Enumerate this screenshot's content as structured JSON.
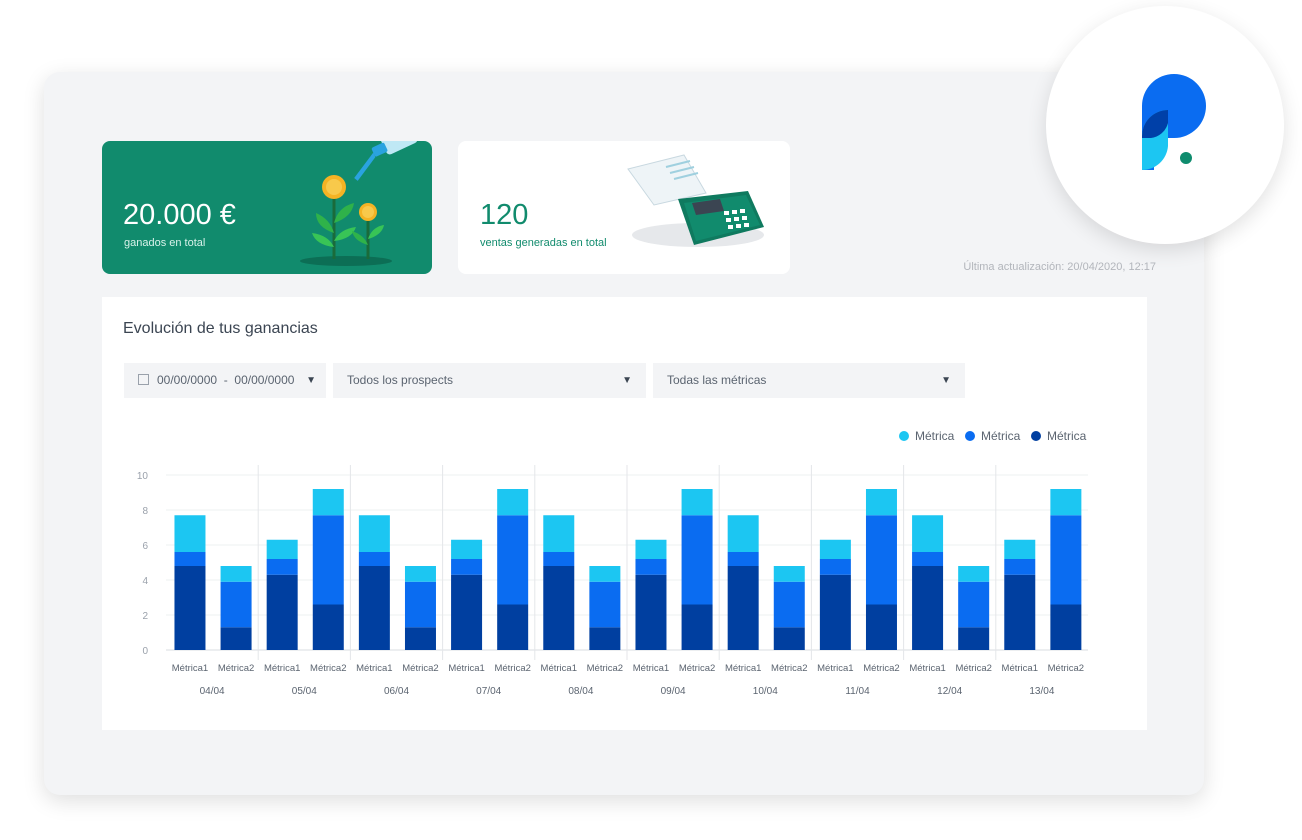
{
  "summary": {
    "earned_value": "20.000 €",
    "earned_label": "ganados en total",
    "sales_value": "120",
    "sales_label": "ventas generadas en total",
    "last_update": "Última actualización: 20/04/2020, 12:17"
  },
  "filters": {
    "date_range": "00/00/0000  -  00/00/0000",
    "prospects": "Todos los prospects",
    "metrics": "Todas las métricas"
  },
  "chart_data": {
    "type": "bar",
    "stacked": true,
    "title": "Evolución de tus ganancias",
    "ylim": [
      0,
      10
    ],
    "yticks": [
      0,
      2,
      4,
      6,
      8,
      10
    ],
    "grid": true,
    "legend_position": "top-right",
    "legend": [
      "Métrica",
      "Métrica",
      "Métrica"
    ],
    "colors": [
      "#003fa0",
      "#0a6cf1",
      "#1cc6f2"
    ],
    "groups": [
      "04/04",
      "05/04",
      "06/04",
      "07/04",
      "08/04",
      "09/04",
      "10/04",
      "11/04",
      "12/04",
      "13/04"
    ],
    "bar_labels": [
      "Métrica1",
      "Métrica2"
    ],
    "bars": [
      [
        [
          4.8,
          0.8,
          2.1
        ],
        [
          1.3,
          2.6,
          0.9
        ]
      ],
      [
        [
          4.3,
          0.9,
          1.1
        ],
        [
          2.6,
          5.1,
          1.5
        ]
      ],
      [
        [
          4.8,
          0.8,
          2.1
        ],
        [
          1.3,
          2.6,
          0.9
        ]
      ],
      [
        [
          4.3,
          0.9,
          1.1
        ],
        [
          2.6,
          5.1,
          1.5
        ]
      ],
      [
        [
          4.8,
          0.8,
          2.1
        ],
        [
          1.3,
          2.6,
          0.9
        ]
      ],
      [
        [
          4.3,
          0.9,
          1.1
        ],
        [
          2.6,
          5.1,
          1.5
        ]
      ],
      [
        [
          4.8,
          0.8,
          2.1
        ],
        [
          1.3,
          2.6,
          0.9
        ]
      ],
      [
        [
          4.3,
          0.9,
          1.1
        ],
        [
          2.6,
          5.1,
          1.5
        ]
      ],
      [
        [
          4.8,
          0.8,
          2.1
        ],
        [
          1.3,
          2.6,
          0.9
        ]
      ],
      [
        [
          4.3,
          0.9,
          1.1
        ],
        [
          2.6,
          5.1,
          1.5
        ]
      ]
    ]
  }
}
